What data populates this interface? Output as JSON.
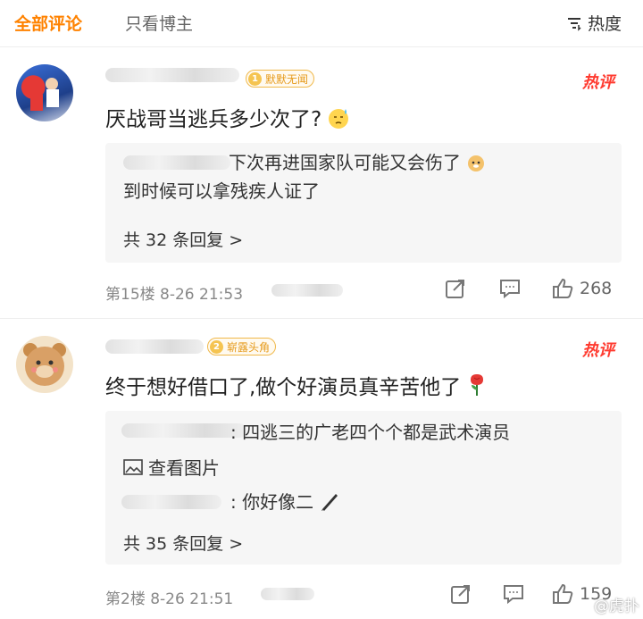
{
  "tabs": {
    "all": "全部评论",
    "op_only": "只看博主",
    "sort": "热度"
  },
  "comments": [
    {
      "badge_num": "1",
      "badge_text": "默默无闻",
      "hot": "热评",
      "content": "厌战哥当逃兵多少次了?",
      "replies": [
        {
          "text": "下次再进国家队可能又会伤了"
        },
        {
          "text": "到时候可以拿残疾人证了"
        }
      ],
      "more": "共 32 条回复 >",
      "meta": "第15楼 8-26 21:53",
      "likes": "268"
    },
    {
      "badge_num": "2",
      "badge_text": "崭露头角",
      "hot": "热评",
      "content": "终于想好借口了,做个好演员真辛苦他了",
      "replies": [
        {
          "text": ": 四逃三的广老四个个都是武术演员"
        },
        {
          "text": "查看图片"
        },
        {
          "text": ": 你好像二"
        }
      ],
      "more": "共 35 条回复 >",
      "meta": "第2楼 8-26 21:51",
      "likes": "159"
    }
  ],
  "watermark": "@虎扑"
}
